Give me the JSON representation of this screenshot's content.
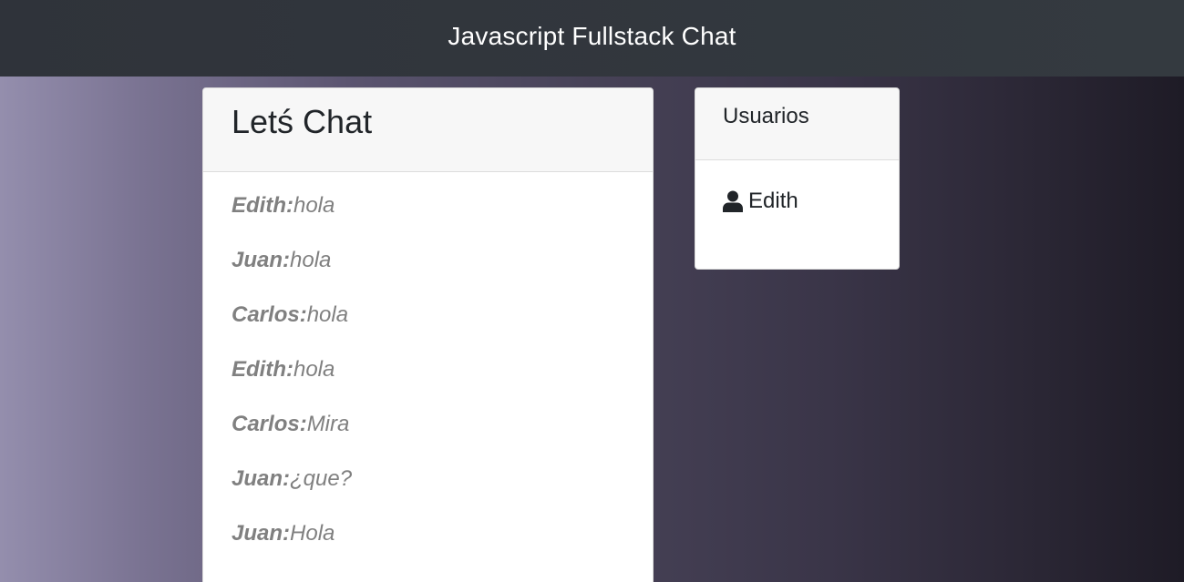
{
  "navbar": {
    "title": "Javascript Fullstack Chat"
  },
  "chat": {
    "title": "Letś Chat",
    "messages": [
      {
        "author": "Edith:",
        "text": "hola"
      },
      {
        "author": "Juan:",
        "text": "hola"
      },
      {
        "author": "Carlos:",
        "text": "hola"
      },
      {
        "author": "Edith:",
        "text": "hola"
      },
      {
        "author": "Carlos:",
        "text": "Mira"
      },
      {
        "author": "Juan:",
        "text": "¿que?"
      },
      {
        "author": "Juan:",
        "text": "Hola"
      }
    ]
  },
  "users": {
    "title": "Usuarios",
    "list": [
      {
        "name": "Edith",
        "icon": "user-icon"
      }
    ]
  },
  "colors": {
    "navbar": "#343a40",
    "message_text": "#808080",
    "card_header": "#f7f7f7"
  }
}
